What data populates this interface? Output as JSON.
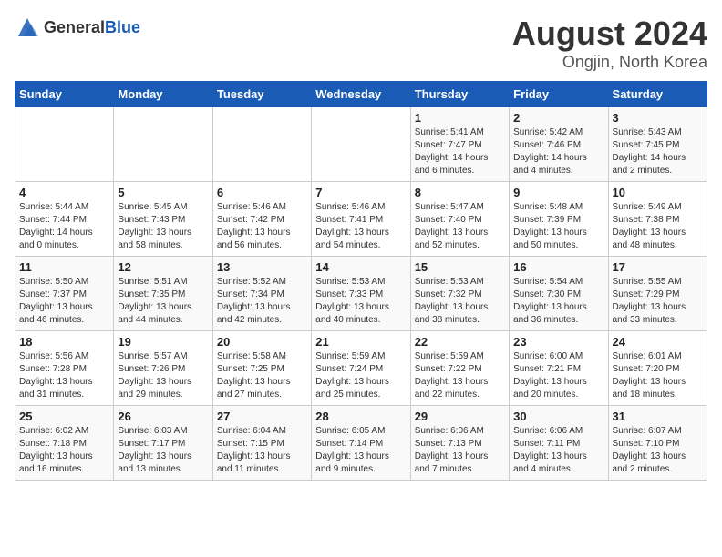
{
  "header": {
    "logo_general": "General",
    "logo_blue": "Blue",
    "main_title": "August 2024",
    "sub_title": "Ongjin, North Korea"
  },
  "calendar": {
    "days_of_week": [
      "Sunday",
      "Monday",
      "Tuesday",
      "Wednesday",
      "Thursday",
      "Friday",
      "Saturday"
    ],
    "weeks": [
      [
        {
          "day": "",
          "info": ""
        },
        {
          "day": "",
          "info": ""
        },
        {
          "day": "",
          "info": ""
        },
        {
          "day": "",
          "info": ""
        },
        {
          "day": "1",
          "info": "Sunrise: 5:41 AM\nSunset: 7:47 PM\nDaylight: 14 hours\nand 6 minutes."
        },
        {
          "day": "2",
          "info": "Sunrise: 5:42 AM\nSunset: 7:46 PM\nDaylight: 14 hours\nand 4 minutes."
        },
        {
          "day": "3",
          "info": "Sunrise: 5:43 AM\nSunset: 7:45 PM\nDaylight: 14 hours\nand 2 minutes."
        }
      ],
      [
        {
          "day": "4",
          "info": "Sunrise: 5:44 AM\nSunset: 7:44 PM\nDaylight: 14 hours\nand 0 minutes."
        },
        {
          "day": "5",
          "info": "Sunrise: 5:45 AM\nSunset: 7:43 PM\nDaylight: 13 hours\nand 58 minutes."
        },
        {
          "day": "6",
          "info": "Sunrise: 5:46 AM\nSunset: 7:42 PM\nDaylight: 13 hours\nand 56 minutes."
        },
        {
          "day": "7",
          "info": "Sunrise: 5:46 AM\nSunset: 7:41 PM\nDaylight: 13 hours\nand 54 minutes."
        },
        {
          "day": "8",
          "info": "Sunrise: 5:47 AM\nSunset: 7:40 PM\nDaylight: 13 hours\nand 52 minutes."
        },
        {
          "day": "9",
          "info": "Sunrise: 5:48 AM\nSunset: 7:39 PM\nDaylight: 13 hours\nand 50 minutes."
        },
        {
          "day": "10",
          "info": "Sunrise: 5:49 AM\nSunset: 7:38 PM\nDaylight: 13 hours\nand 48 minutes."
        }
      ],
      [
        {
          "day": "11",
          "info": "Sunrise: 5:50 AM\nSunset: 7:37 PM\nDaylight: 13 hours\nand 46 minutes."
        },
        {
          "day": "12",
          "info": "Sunrise: 5:51 AM\nSunset: 7:35 PM\nDaylight: 13 hours\nand 44 minutes."
        },
        {
          "day": "13",
          "info": "Sunrise: 5:52 AM\nSunset: 7:34 PM\nDaylight: 13 hours\nand 42 minutes."
        },
        {
          "day": "14",
          "info": "Sunrise: 5:53 AM\nSunset: 7:33 PM\nDaylight: 13 hours\nand 40 minutes."
        },
        {
          "day": "15",
          "info": "Sunrise: 5:53 AM\nSunset: 7:32 PM\nDaylight: 13 hours\nand 38 minutes."
        },
        {
          "day": "16",
          "info": "Sunrise: 5:54 AM\nSunset: 7:30 PM\nDaylight: 13 hours\nand 36 minutes."
        },
        {
          "day": "17",
          "info": "Sunrise: 5:55 AM\nSunset: 7:29 PM\nDaylight: 13 hours\nand 33 minutes."
        }
      ],
      [
        {
          "day": "18",
          "info": "Sunrise: 5:56 AM\nSunset: 7:28 PM\nDaylight: 13 hours\nand 31 minutes."
        },
        {
          "day": "19",
          "info": "Sunrise: 5:57 AM\nSunset: 7:26 PM\nDaylight: 13 hours\nand 29 minutes."
        },
        {
          "day": "20",
          "info": "Sunrise: 5:58 AM\nSunset: 7:25 PM\nDaylight: 13 hours\nand 27 minutes."
        },
        {
          "day": "21",
          "info": "Sunrise: 5:59 AM\nSunset: 7:24 PM\nDaylight: 13 hours\nand 25 minutes."
        },
        {
          "day": "22",
          "info": "Sunrise: 5:59 AM\nSunset: 7:22 PM\nDaylight: 13 hours\nand 22 minutes."
        },
        {
          "day": "23",
          "info": "Sunrise: 6:00 AM\nSunset: 7:21 PM\nDaylight: 13 hours\nand 20 minutes."
        },
        {
          "day": "24",
          "info": "Sunrise: 6:01 AM\nSunset: 7:20 PM\nDaylight: 13 hours\nand 18 minutes."
        }
      ],
      [
        {
          "day": "25",
          "info": "Sunrise: 6:02 AM\nSunset: 7:18 PM\nDaylight: 13 hours\nand 16 minutes."
        },
        {
          "day": "26",
          "info": "Sunrise: 6:03 AM\nSunset: 7:17 PM\nDaylight: 13 hours\nand 13 minutes."
        },
        {
          "day": "27",
          "info": "Sunrise: 6:04 AM\nSunset: 7:15 PM\nDaylight: 13 hours\nand 11 minutes."
        },
        {
          "day": "28",
          "info": "Sunrise: 6:05 AM\nSunset: 7:14 PM\nDaylight: 13 hours\nand 9 minutes."
        },
        {
          "day": "29",
          "info": "Sunrise: 6:06 AM\nSunset: 7:13 PM\nDaylight: 13 hours\nand 7 minutes."
        },
        {
          "day": "30",
          "info": "Sunrise: 6:06 AM\nSunset: 7:11 PM\nDaylight: 13 hours\nand 4 minutes."
        },
        {
          "day": "31",
          "info": "Sunrise: 6:07 AM\nSunset: 7:10 PM\nDaylight: 13 hours\nand 2 minutes."
        }
      ]
    ]
  }
}
